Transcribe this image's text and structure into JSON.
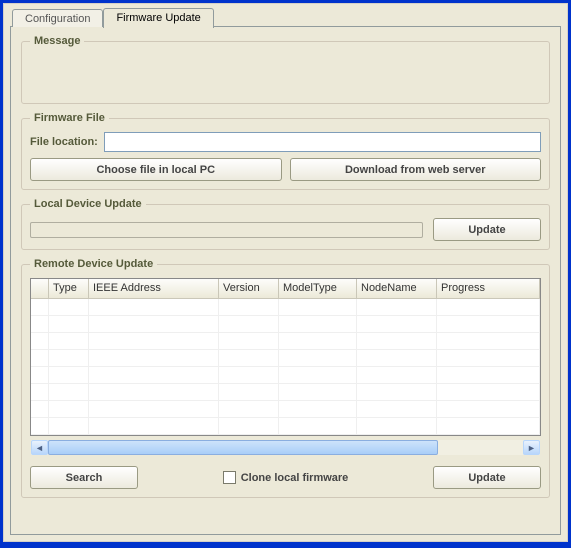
{
  "tabs": {
    "configuration": "Configuration",
    "firmware": "Firmware Update"
  },
  "message": {
    "legend": "Message"
  },
  "firmware_file": {
    "legend": "Firmware File",
    "location_label": "File location:",
    "location_value": "",
    "choose_label": "Choose file in local PC",
    "download_label": "Download from web server"
  },
  "local_update": {
    "legend": "Local Device Update",
    "update_label": "Update"
  },
  "remote_update": {
    "legend": "Remote Device Update",
    "columns": {
      "blank": "",
      "type": "Type",
      "ieee": "IEEE Address",
      "version": "Version",
      "modeltype": "ModelType",
      "nodename": "NodeName",
      "progress": "Progress"
    },
    "search_label": "Search",
    "clone_label": "Clone local firmware",
    "clone_checked": false,
    "update_label": "Update"
  }
}
